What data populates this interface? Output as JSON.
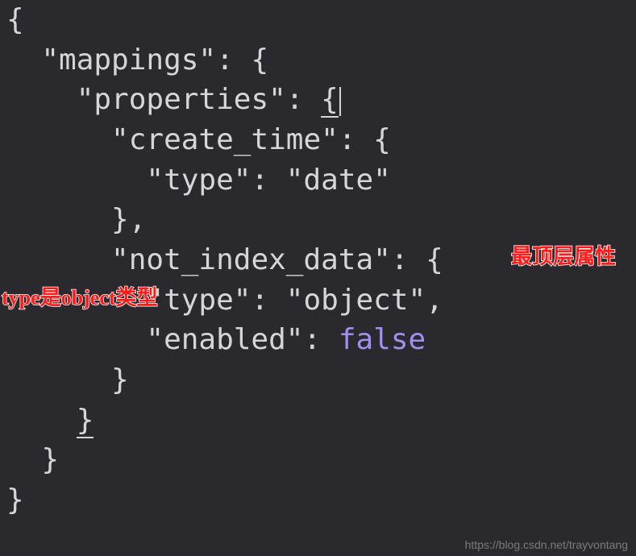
{
  "code": {
    "l1": "{",
    "l2_indent": "  ",
    "l2_key": "\"mappings\"",
    "l2_after": ": {",
    "l3_indent": "    ",
    "l3_key": "\"properties\"",
    "l3_after": ": ",
    "l3_brace": "{",
    "l4_indent": "      ",
    "l4_key": "\"create_time\"",
    "l4_after": ": {",
    "l5_indent": "        ",
    "l5_key": "\"type\"",
    "l5_after": ": ",
    "l5_val": "\"date\"",
    "l6_indent": "      ",
    "l6": "},",
    "l7_indent": "      ",
    "l7_key": "\"not_index_data\"",
    "l7_after": ": {",
    "l8_indent": "        ",
    "l8_key": "\"type\"",
    "l8_after": ": ",
    "l8_val": "\"object\"",
    "l8_end": ",",
    "l9_indent": "        ",
    "l9_key": "\"enabled\"",
    "l9_after": ": ",
    "l9_val": "false",
    "l10_indent": "      ",
    "l10": "}",
    "l11_indent": "    ",
    "l11": "}",
    "l12_indent": "  ",
    "l12": "}",
    "l13": "}"
  },
  "annotations": {
    "right": "最顶层属性",
    "left": "type是object类型"
  },
  "watermark": "https://blog.csdn.net/trayvontang"
}
